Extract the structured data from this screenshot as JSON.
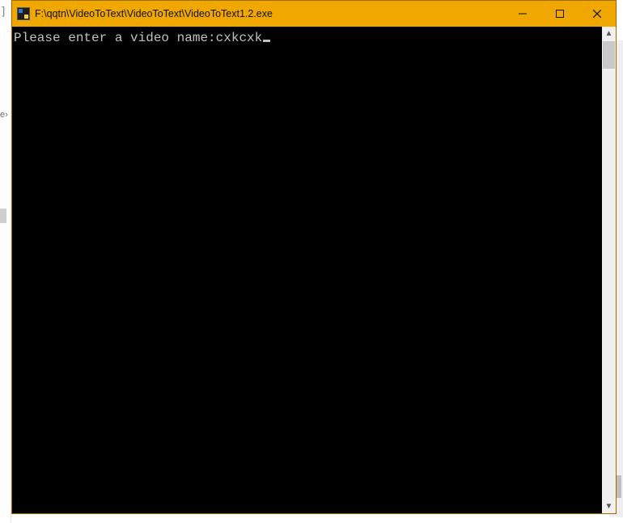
{
  "window": {
    "title": "F:\\qqtn\\VideoToText\\VideoToText\\VideoToText1.2.exe"
  },
  "console": {
    "prompt": "Please enter a video name:",
    "input_value": "cxkcxk"
  },
  "background": {
    "left_bracket": "]",
    "frag_text": "e›"
  },
  "icons": {
    "minimize": "minimize-icon",
    "maximize": "maximize-icon",
    "close": "close-icon",
    "scroll_up": "▲",
    "scroll_down": "▼"
  }
}
